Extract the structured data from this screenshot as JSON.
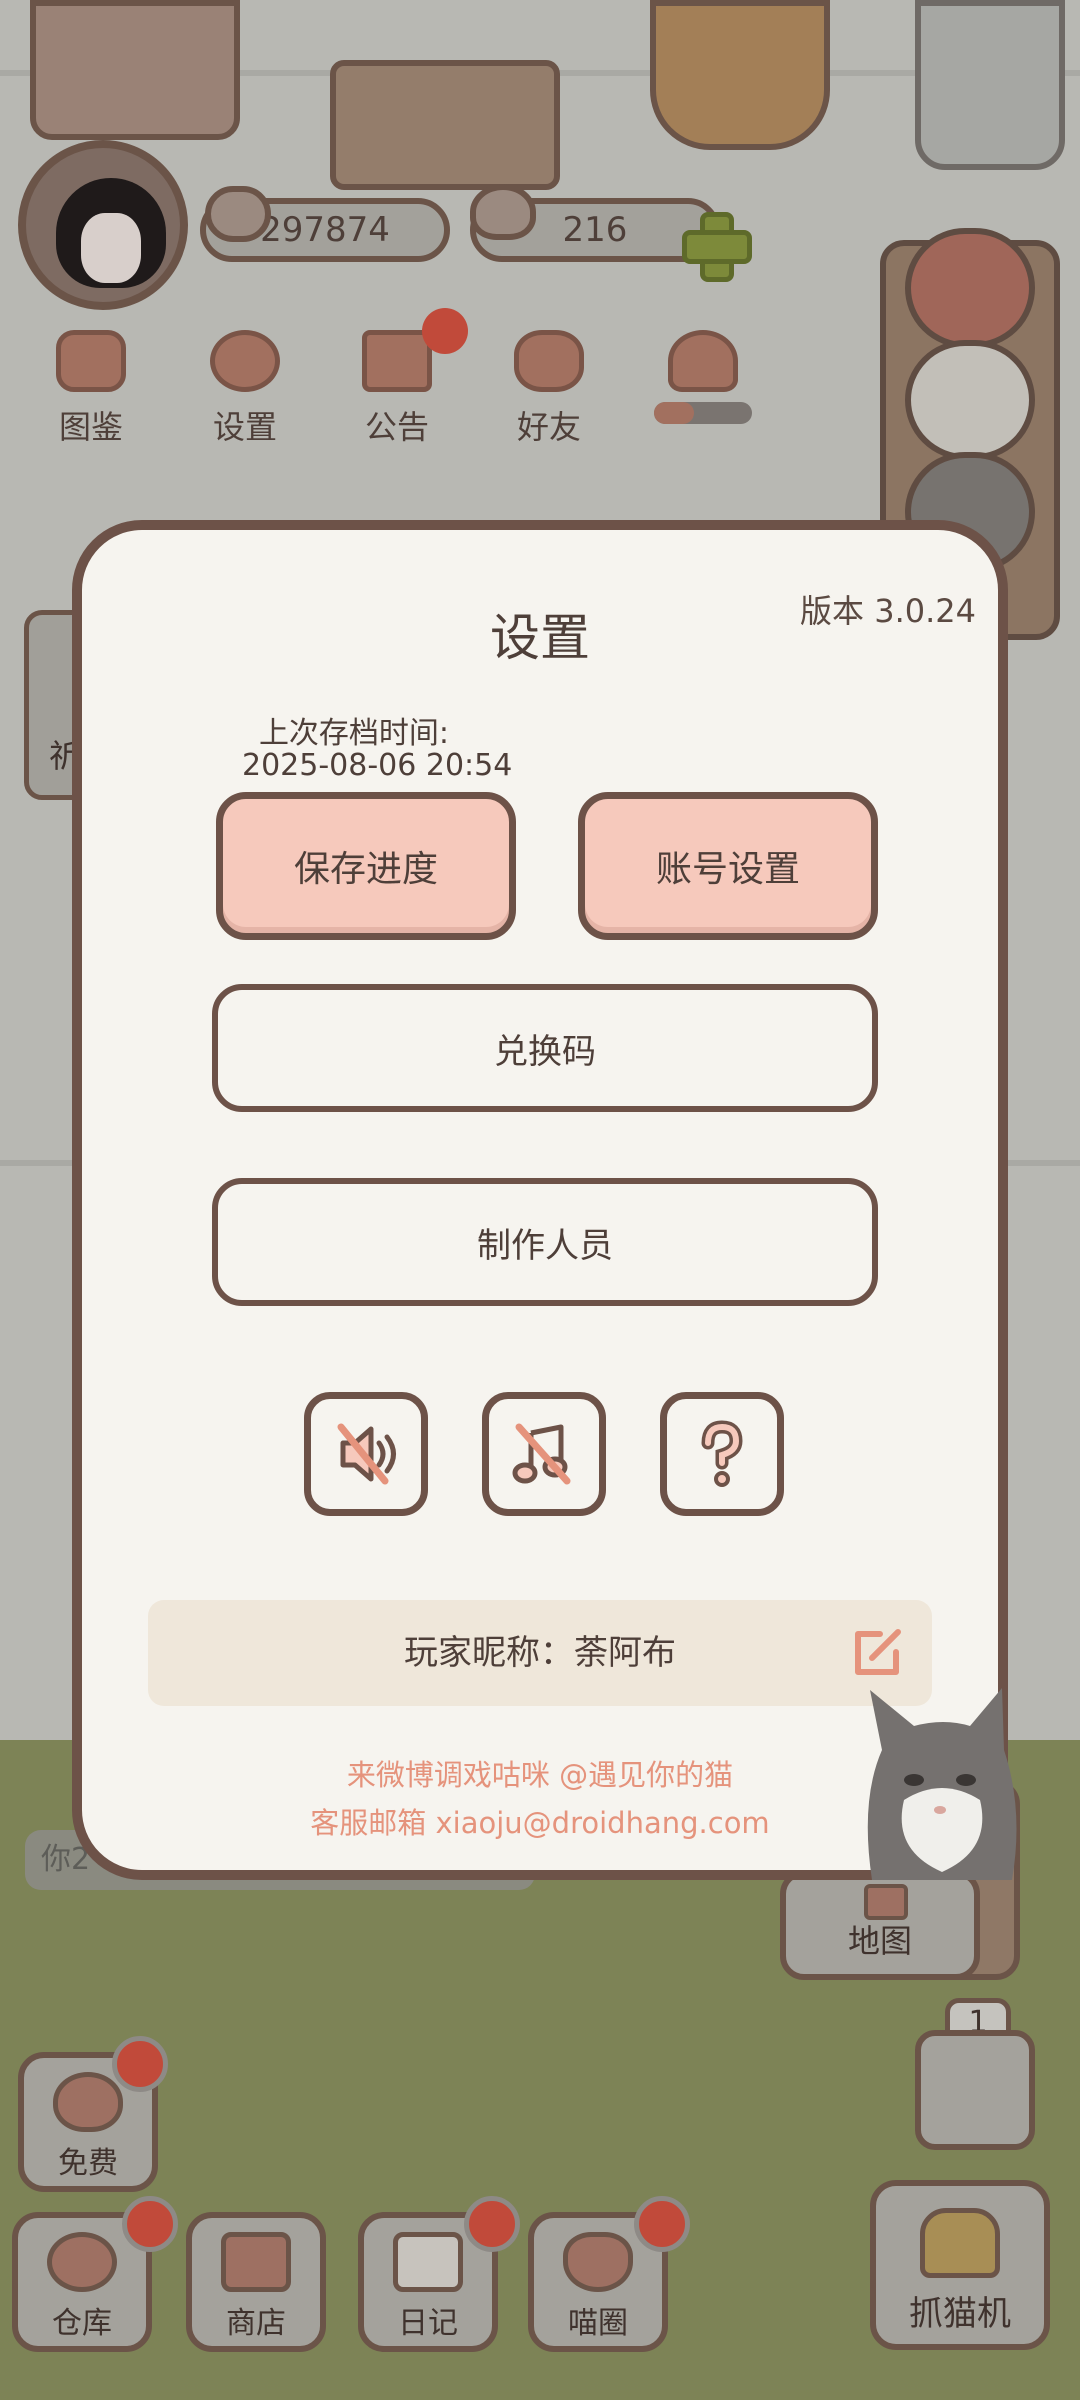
{
  "hud": {
    "coins": "297874",
    "hearts": "216",
    "buttons": [
      {
        "label": "图鉴"
      },
      {
        "label": "设置"
      },
      {
        "label": "公告"
      },
      {
        "label": "好友"
      }
    ]
  },
  "scene": {
    "left_side_label": "祈",
    "chat_preview": "你2",
    "map_label": "地图",
    "machine_count": "1"
  },
  "bottom_bar": {
    "free": "免费",
    "warehouse": "仓库",
    "shop": "商店",
    "diary": "日记",
    "circle": "喵圈",
    "claw_machine": "抓猫机"
  },
  "dialog": {
    "title": "设置",
    "version": "版本 3.0.24",
    "last_save_label": "上次存档时间:",
    "last_save_time": "2025-08-06 20:54",
    "save_button": "保存进度",
    "account_button": "账号设置",
    "redeem_button": "兑换码",
    "credits_button": "制作人员",
    "icons": {
      "sound": "speaker-muted-icon",
      "music": "music-muted-icon",
      "help": "question-icon"
    },
    "player_nickname": "玩家昵称：荼阿布",
    "weibo_text": "来微博调戏咕咪 @遇见你的猫",
    "email_text": "客服邮箱 xiaoju@droidhang.com",
    "colors": {
      "accent_pink": "#f6c9bc",
      "border_brown": "#6d5248",
      "link_orange": "#e5937c"
    }
  }
}
